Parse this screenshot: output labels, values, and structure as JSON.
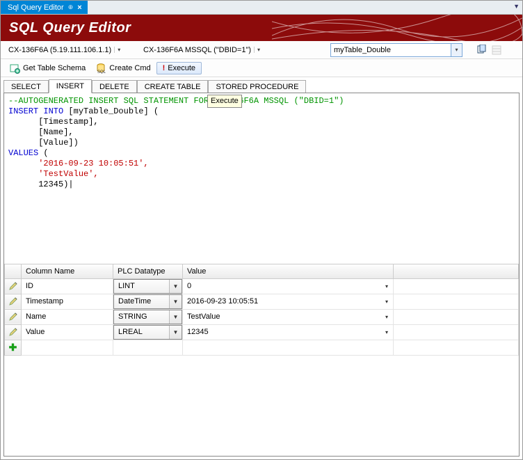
{
  "window": {
    "tab_title": "Sql Query Editor"
  },
  "banner": {
    "title": "SQL Query Editor"
  },
  "connection": {
    "target": "CX-136F6A (5.19.111.106.1.1)",
    "dsn": "CX-136F6A MSSQL (\"DBID=1\")",
    "table": "myTable_Double"
  },
  "toolbar": {
    "schema": "Get Table Schema",
    "create": "Create Cmd",
    "execute": "Execute"
  },
  "tooltip": {
    "execute": "Execute"
  },
  "sql_tabs": [
    "SELECT",
    "INSERT",
    "DELETE",
    "CREATE TABLE",
    "STORED PROCEDURE"
  ],
  "sql_active_tab": 1,
  "sql": {
    "l1": "--AUTOGENERATED INSERT SQL STATEMENT FOR CX-136F6A MSSQL (\"DBID=1\")",
    "l2a": "INSERT INTO",
    "l2b": " [myTable_Double] (",
    "l3": "      [Timestamp],",
    "l4": "      [Name],",
    "l5": "      [Value])",
    "l6a": "VALUES",
    "l6b": " (",
    "l7": "      '2016-09-23 10:05:51',",
    "l8": "      'TestValue',",
    "l9": "      12345)"
  },
  "grid": {
    "headers": {
      "col": "Column Name",
      "type": "PLC Datatype",
      "val": "Value"
    },
    "rows": [
      {
        "col": "ID",
        "type": "LINT",
        "val": "0"
      },
      {
        "col": "Timestamp",
        "type": "DateTime",
        "val": "2016-09-23 10:05:51"
      },
      {
        "col": "Name",
        "type": "STRING",
        "val": "TestValue"
      },
      {
        "col": "Value",
        "type": "LREAL",
        "val": "12345"
      }
    ]
  }
}
